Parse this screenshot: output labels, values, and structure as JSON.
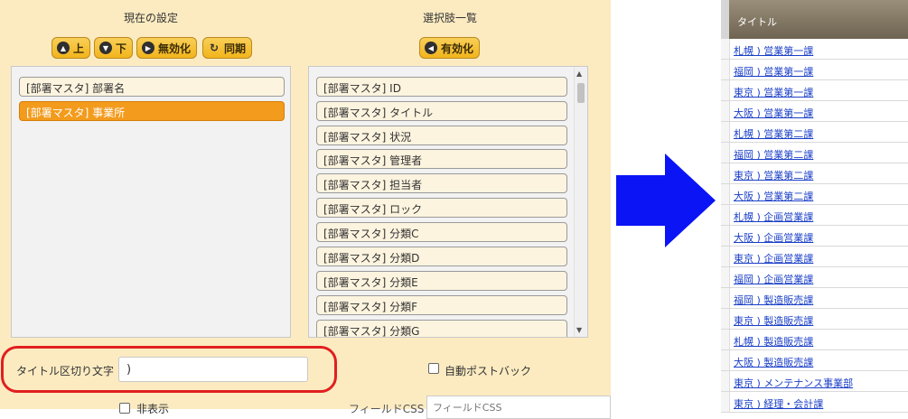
{
  "current_settings": {
    "title": "現在の設定",
    "buttons": {
      "up": "上",
      "down": "下",
      "disable": "無効化",
      "sync": "同期"
    },
    "items": [
      "[部署マスタ] 部署名",
      "[部署マスタ] 事業所"
    ]
  },
  "choices": {
    "title": "選択肢一覧",
    "enable_button": "有効化",
    "items": [
      "[部署マスタ] ID",
      "[部署マスタ] タイトル",
      "[部署マスタ] 状況",
      "[部署マスタ] 管理者",
      "[部署マスタ] 担当者",
      "[部署マスタ] ロック",
      "[部署マスタ] 分類C",
      "[部署マスタ] 分類D",
      "[部署マスタ] 分類E",
      "[部署マスタ] 分類F",
      "[部署マスタ] 分類G"
    ]
  },
  "title_separator": {
    "label": "タイトル区切り文字",
    "value": ")"
  },
  "auto_postback": {
    "label": "自動ポストバック"
  },
  "hidden": {
    "label": "非表示"
  },
  "field_css": {
    "label": "フィールドCSS",
    "placeholder": "フィールドCSS"
  },
  "grid": {
    "header": "タイトル",
    "rows": [
      "札幌 ) 営業第一課",
      "福岡 ) 営業第一課",
      "東京 ) 営業第一課",
      "大阪 ) 営業第一課",
      "札幌 ) 営業第二課",
      "福岡 ) 営業第二課",
      "東京 ) 営業第二課",
      "大阪 ) 営業第二課",
      "札幌 ) 企画営業課",
      "大阪 ) 企画営業課",
      "東京 ) 企画営業課",
      "福岡 ) 企画営業課",
      "福岡 ) 製造販売課",
      "東京 ) 製造販売課",
      "札幌 ) 製造販売課",
      "大阪 ) 製造販売課",
      "東京 ) メンテナンス事業部",
      "東京 ) 経理・会計課"
    ]
  },
  "colors": {
    "accent": "#f39b1c",
    "panel": "#fcebc1",
    "highlight": "#e11f1f",
    "arrow": "#0a14f5",
    "link": "#1a3fc7"
  }
}
